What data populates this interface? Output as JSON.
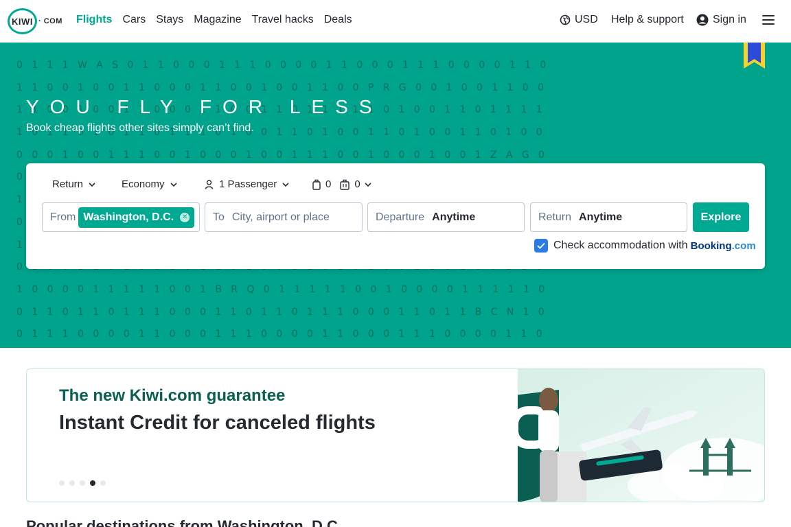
{
  "brand": {
    "logo_text": "KIWI",
    "logo_suffix": "COM"
  },
  "nav": {
    "links": [
      "Flights",
      "Cars",
      "Stays",
      "Magazine",
      "Travel hacks",
      "Deals"
    ],
    "currency": "USD",
    "help": "Help & support",
    "signin": "Sign in"
  },
  "hero": {
    "title": "YOU FLY FOR LESS",
    "subtitle": "Book cheap flights other sites simply can’t find.",
    "matrix_rows": [
      "0 1 1 1 W A S 0 1 1 0 0 0 1 1 1 0 0 0 0 1 1 0 0 0 1 1 1 0 0 0 0 1 1 0",
      "1 1 0 0 1 0 0 1 1 0 0 0 1 1 0 0 1 0 0 1 1 0 0 P R G 0 0 1 0 0 1 1 0 0",
      "1 1 0 0 1 0 0 1 1 0 0 0 1 1 0 0 1 1 0 1 1 1 1 1 0 1 0 0 1 1 0 1 1 1 1",
      "1 0 1 1 0 1 0 1 1 0 1 1 1 0 1 0 0 1 1 0 1 0 0 1 1 0 1 0 0 1 1 0 1 0 0",
      "0 0 0 1 0 0 1 1 1 0 0 1 0 0 0 1 0 0 1 1 1 0 0 1 0 0 0 1 0 0 1 Z A G 0",
      "0 1 0 1 1 0 0 0 1 0 1 0 1 1 0 1 0 0 1 0 1 1 0 1 0 1 1 0 0 1 1 0 1 0 0",
      "1 0 1 1 0 1 0 1 1 0 1 0 0 1 1 0 1 0 1 1 0 0 1 0 1 1 0 1 0 1 1 0 1 0 1",
      "0 0 1 0 1 1 0 0 1 0 1 1 0 1 0 0 1 1 0 1 0 0 1 0 1 1 0 0 1 0 1 1 0 1 0",
      "1 1 0 1 0 0 1 1 0 1 0 1 1 0 0 1 0 1 1 0 1 0 0 1 1 0 1 0 0 1 0 1 1 0 1",
      "0 1 0 0 1 1 0 1 0 0 1 0 1 1 0 1 0 0 1 1 0 1 0 1 0 0 1 1 0 1 0 0 1 1 0",
      "1 0 0 0 0 1 1 1 1 1 0 0 1 B R Q 0 1 1 1 1 1 0 0 1 0 0 0 0 1 1 1 1 1 0",
      "0 1 1 0 1 1 0 1 1 1 0 0 0 1 1 0 1 1 0 1 1 1 0 0 0 1 1 0 1 1 B C N 1 0",
      "0 1 1 1 0 0 0 0 1 1 0 0 0 1 1 1 0 0 0 0 1 1 0 0 0 1 1 1 0 0 0 0 1 1 0"
    ]
  },
  "search": {
    "trip_type": "Return",
    "cabin": "Economy",
    "passengers": "1 Passenger",
    "cabin_bags": "0",
    "checked_bags": "0",
    "from_label": "From",
    "from_value": "Washington, D.C.",
    "to_label": "To",
    "to_placeholder": "City, airport or place",
    "departure_label": "Departure",
    "departure_value": "Anytime",
    "return_label": "Return",
    "return_value": "Anytime",
    "explore": "Explore",
    "accommodation_text": "Check accommodation with",
    "booking_brand": "Booking",
    "booking_suffix": ".com",
    "accommodation_checked": true
  },
  "promo": {
    "kicker": "The new Kiwi.com guarantee",
    "title": "Instant Credit for canceled flights",
    "slides": 5,
    "active_slide": 4
  },
  "section": {
    "title": "Popular destinations from Washington, D.C."
  },
  "colors": {
    "brand_green": "#00a991",
    "hero_green": "#00a38b",
    "text": "#252a31",
    "checkbox_blue": "#2c7be5"
  }
}
